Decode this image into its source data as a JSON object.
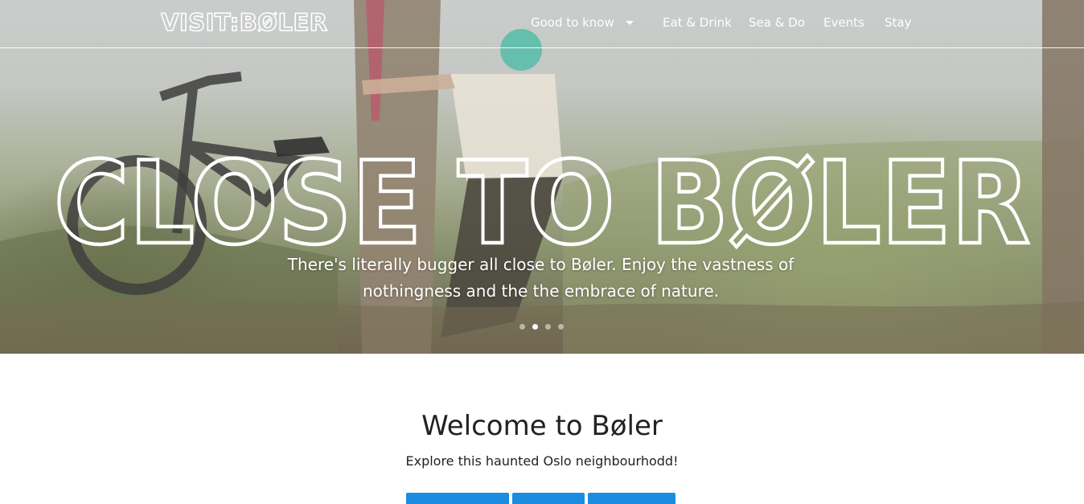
{
  "header": {
    "logo_text": "VISIT:BØLER",
    "nav": [
      {
        "label": "Good to know",
        "has_dropdown": true
      },
      {
        "label": "Eat & Drink"
      },
      {
        "label": "Sea & Do"
      },
      {
        "label": "Events"
      },
      {
        "label": "Stay"
      }
    ]
  },
  "hero": {
    "headline": "CLOSE TO BØLER",
    "subtitle": "There's literally bugger all close to Bøler. Enjoy the vastness of nothingness and the the embrace of nature.",
    "carousel": {
      "slides": 4,
      "active_index": 1
    }
  },
  "main": {
    "title": "Welcome to Bøler",
    "subtitle": "Explore this haunted Oslo neighbourhodd!",
    "buttons": [
      {
        "label": ""
      },
      {
        "label": ""
      },
      {
        "label": ""
      }
    ]
  },
  "colors": {
    "nav_text": "#ffffff",
    "button_blue": "#1a8de0",
    "text_dark": "#222222"
  }
}
